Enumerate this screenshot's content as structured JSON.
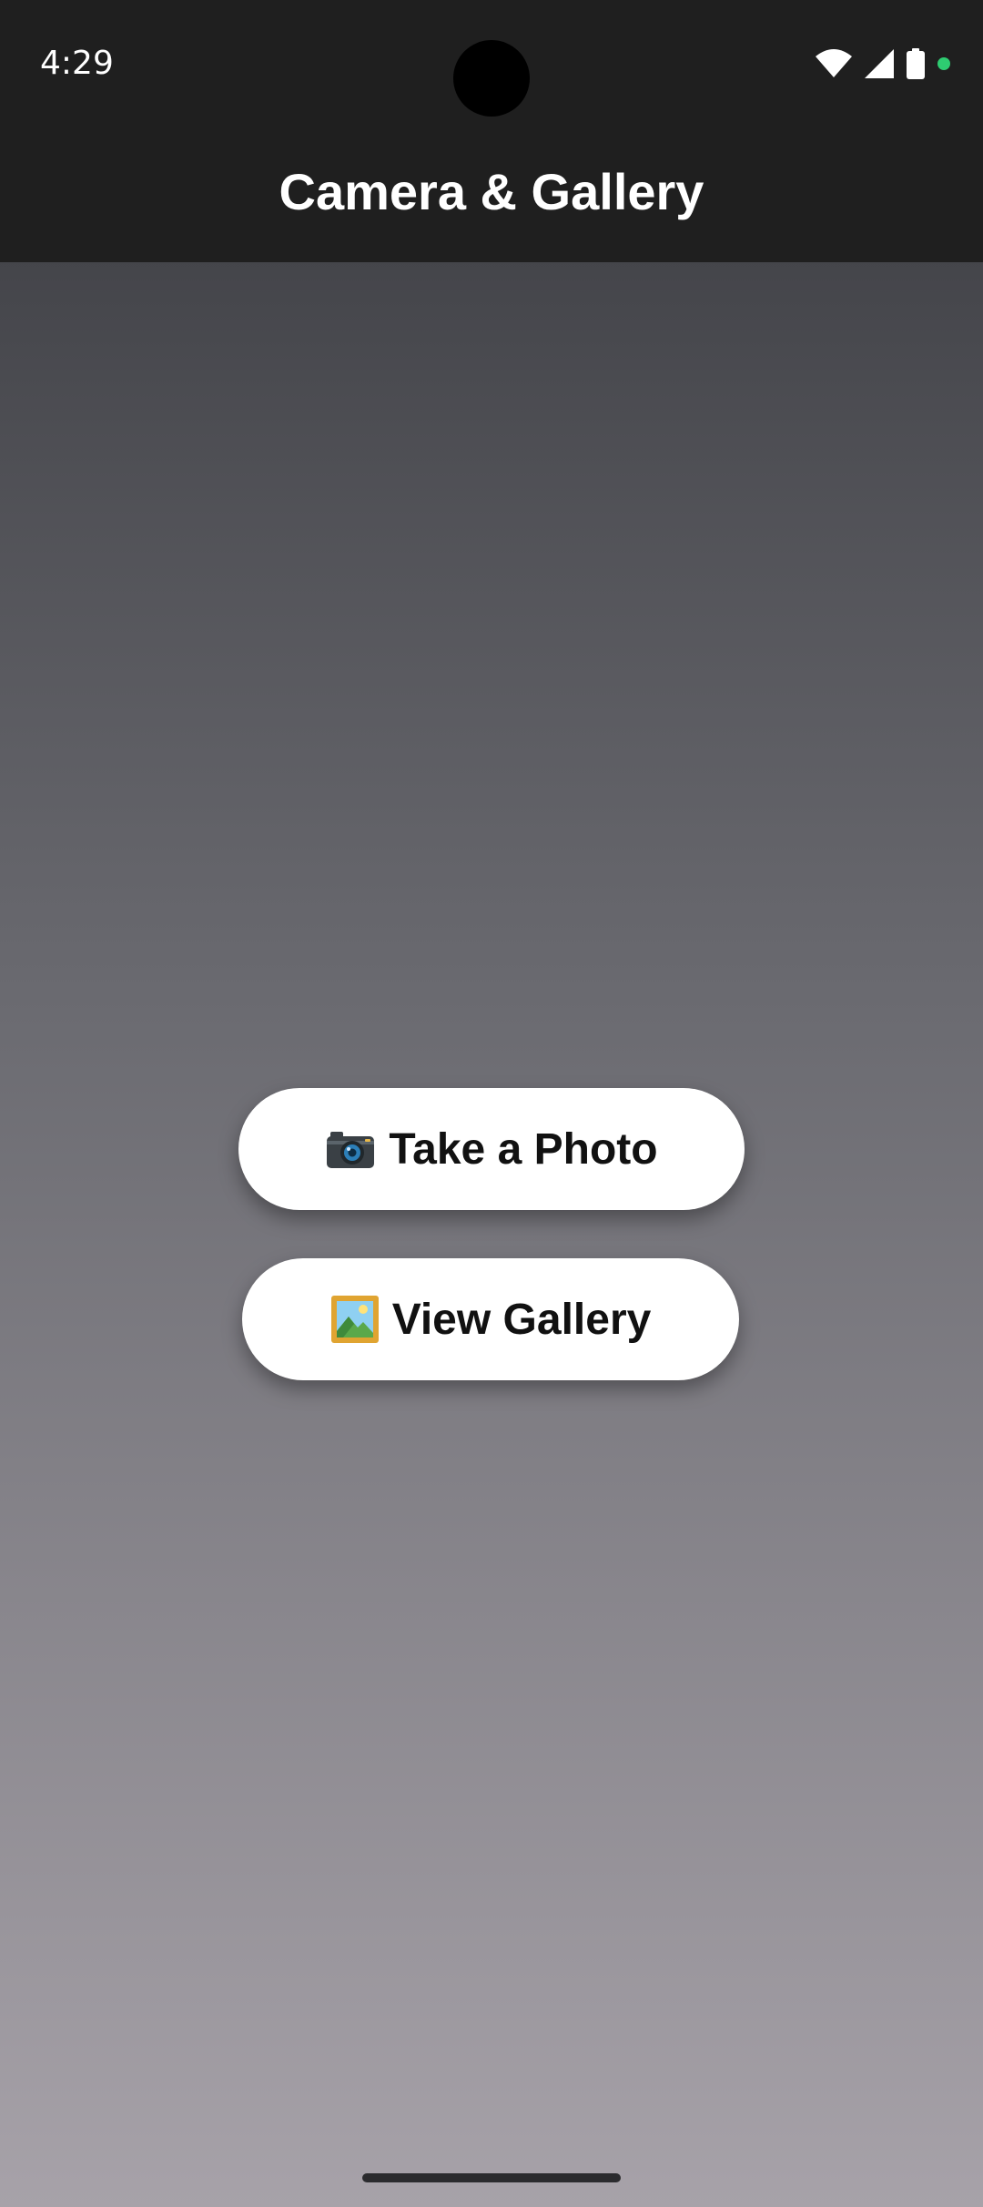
{
  "status_bar": {
    "time": "4:29",
    "icons": [
      "wifi-icon",
      "cellular-signal-icon",
      "battery-icon",
      "privacy-indicator-dot"
    ],
    "indicator_color": "#2ecc71"
  },
  "app_bar": {
    "title": "Camera & Gallery",
    "background": "#1f1f1f"
  },
  "main": {
    "buttons": [
      {
        "label": "Take a Photo",
        "icon": "camera-icon"
      },
      {
        "label": "View Gallery",
        "icon": "framed-picture-icon"
      }
    ],
    "background_gradient": [
      "#37383d",
      "#6a6a70",
      "#a7a2a9"
    ]
  },
  "system": {
    "home_indicator": "home-indicator"
  }
}
